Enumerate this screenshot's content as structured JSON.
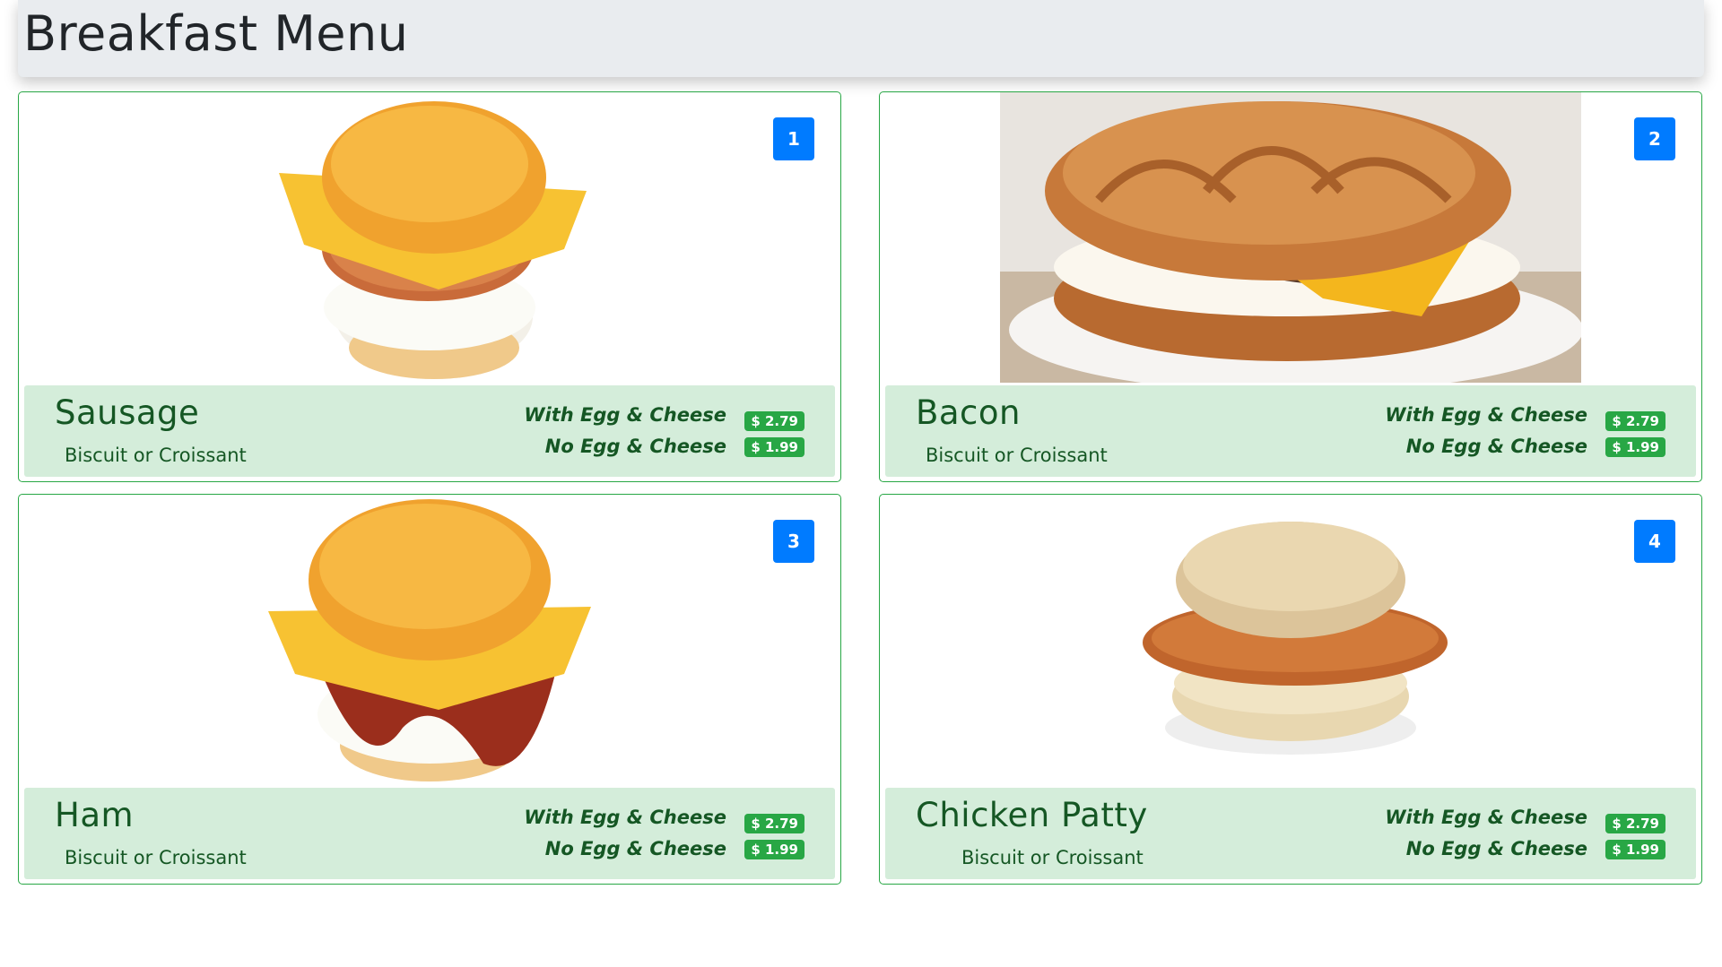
{
  "header": {
    "title": "Breakfast Menu"
  },
  "items": [
    {
      "number": "1",
      "name": "Sausage",
      "subtitle": "Biscuit or Croissant",
      "option1": "With Egg & Cheese",
      "price1": "$ 2.79",
      "option2": "No Egg & Cheese",
      "price2": "$ 1.99",
      "image": "sausage-biscuit-sandwich"
    },
    {
      "number": "2",
      "name": "Bacon",
      "subtitle": "Biscuit or Croissant",
      "option1": "With Egg & Cheese",
      "price1": "$ 2.79",
      "option2": "No Egg & Cheese",
      "price2": "$ 1.99",
      "image": "croissant-sandwich-photo"
    },
    {
      "number": "3",
      "name": "Ham",
      "subtitle": "Biscuit or Croissant",
      "option1": "With Egg & Cheese",
      "price1": "$ 2.79",
      "option2": "No Egg & Cheese",
      "price2": "$ 1.99",
      "image": "bacon-biscuit-sandwich"
    },
    {
      "number": "4",
      "name": "Chicken Patty",
      "subtitle": "Biscuit or Croissant",
      "option1": "With Egg & Cheese",
      "price1": "$ 2.79",
      "option2": "No Egg & Cheese",
      "price2": "$ 1.99",
      "image": "chicken-biscuit-sandwich"
    }
  ],
  "colors": {
    "card_border": "#28a745",
    "footer_bg": "#d4edda",
    "text_green": "#155724",
    "badge_blue": "#007bff",
    "header_bg": "#e9ecef"
  }
}
